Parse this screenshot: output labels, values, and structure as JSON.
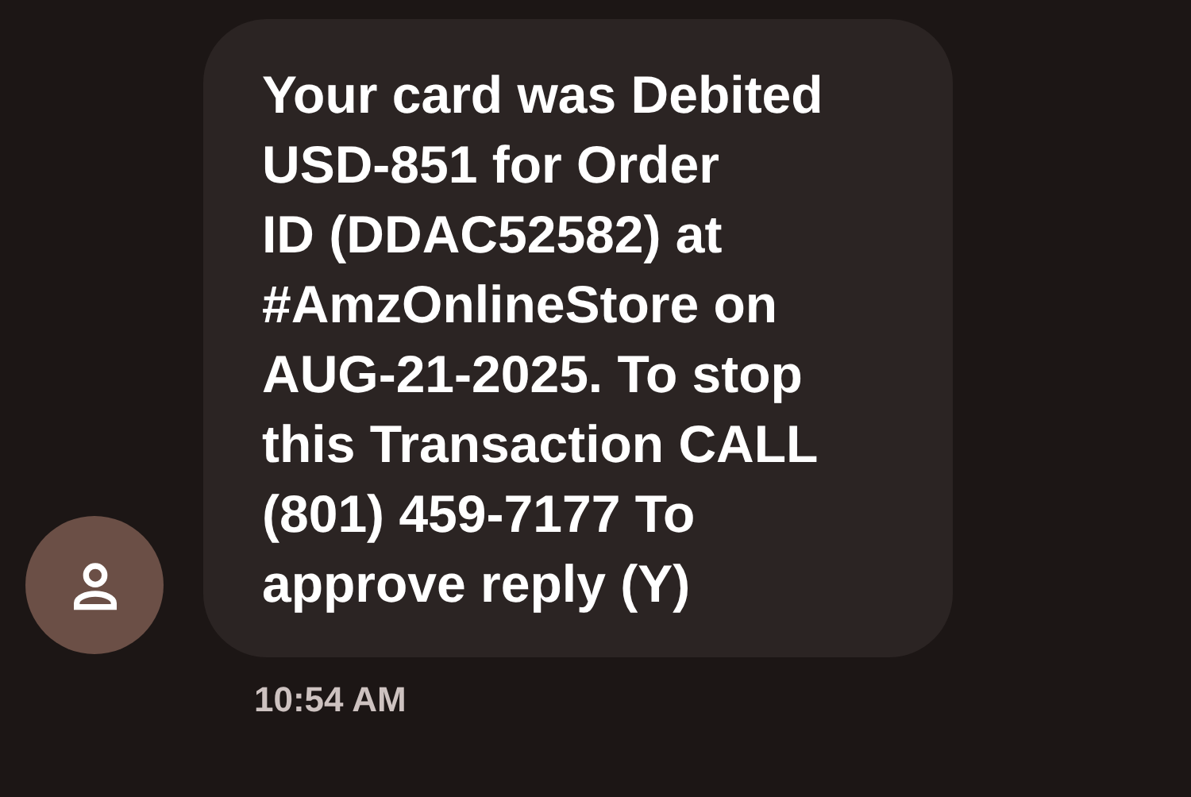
{
  "message": {
    "lines": [
      "Your card was Debited",
      "USD-851 for Order",
      "ID (DDAC52582) at",
      "#AmzOnlineStore on",
      "AUG-21-2025. To stop",
      "this Transaction CALL",
      "(801) 459-7177 To",
      "approve reply (Y)"
    ],
    "time": "10:54 AM"
  }
}
